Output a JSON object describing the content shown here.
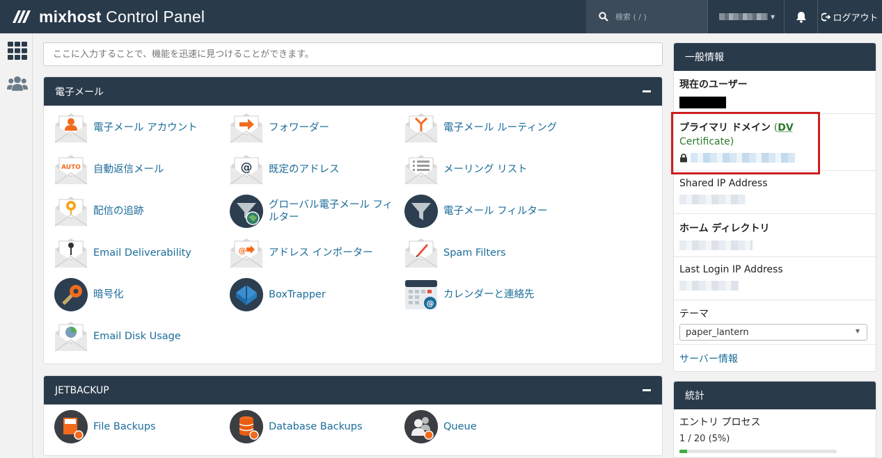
{
  "header": {
    "brand_name": "mixhost",
    "brand_suffix": " Control Panel",
    "search_placeholder": "検索 ( / )",
    "logout_label": "ログアウト"
  },
  "quick_search": {
    "placeholder": "ここに入力することで、機能を迅速に見つけることができます。"
  },
  "email_panel": {
    "title": "電子メール",
    "items": [
      {
        "label": "電子メール アカウント",
        "icon": "email-account-icon"
      },
      {
        "label": "フォワーダー",
        "icon": "forwarder-icon"
      },
      {
        "label": "電子メール ルーティング",
        "icon": "email-routing-icon"
      },
      {
        "label": "自動返信メール",
        "icon": "autoresponder-icon"
      },
      {
        "label": "既定のアドレス",
        "icon": "default-address-icon"
      },
      {
        "label": "メーリング リスト",
        "icon": "mailing-list-icon"
      },
      {
        "label": "配信の追跡",
        "icon": "track-delivery-icon"
      },
      {
        "label": "グローバル電子メール フィルター",
        "icon": "global-filter-icon"
      },
      {
        "label": "電子メール フィルター",
        "icon": "email-filter-icon"
      },
      {
        "label": "Email Deliverability",
        "icon": "deliverability-icon"
      },
      {
        "label": "アドレス インポーター",
        "icon": "address-importer-icon"
      },
      {
        "label": "Spam Filters",
        "icon": "spam-filters-icon"
      },
      {
        "label": "暗号化",
        "icon": "encryption-icon"
      },
      {
        "label": "BoxTrapper",
        "icon": "boxtrapper-icon"
      },
      {
        "label": "カレンダーと連絡先",
        "icon": "calendar-contacts-icon"
      },
      {
        "label": "Email Disk Usage",
        "icon": "disk-usage-icon"
      }
    ]
  },
  "jetbackup_panel": {
    "title": "JETBACKUP",
    "items": [
      {
        "label": "File Backups",
        "icon": "file-backups-icon"
      },
      {
        "label": "Database Backups",
        "icon": "database-backups-icon"
      },
      {
        "label": "Queue",
        "icon": "queue-icon"
      }
    ]
  },
  "general_info": {
    "title": "一般情報",
    "current_user_label": "現在のユーザー",
    "primary_domain_label": "プライマリ ドメイン",
    "dv_open": "(",
    "dv_link": "DV",
    "dv_cert": "Certificate)",
    "shared_ip_label": "Shared IP Address",
    "home_dir_label": "ホーム ディレクトリ",
    "last_login_label": "Last Login IP Address",
    "theme_label": "テーマ",
    "theme_value": "paper_lantern",
    "server_info_link": "サーバー情報"
  },
  "stats": {
    "title": "統計",
    "entry_processes_label": "エントリ プロセス",
    "entry_processes_value": "1 / 20   (5%)",
    "entry_processes_fraction": 0.05
  },
  "colors": {
    "header_bg": "#293a4a",
    "link": "#1b6c9a",
    "highlight_border": "#cc1f1f",
    "ssl_green": "#2d7a2d",
    "progress": "#3cb043"
  }
}
